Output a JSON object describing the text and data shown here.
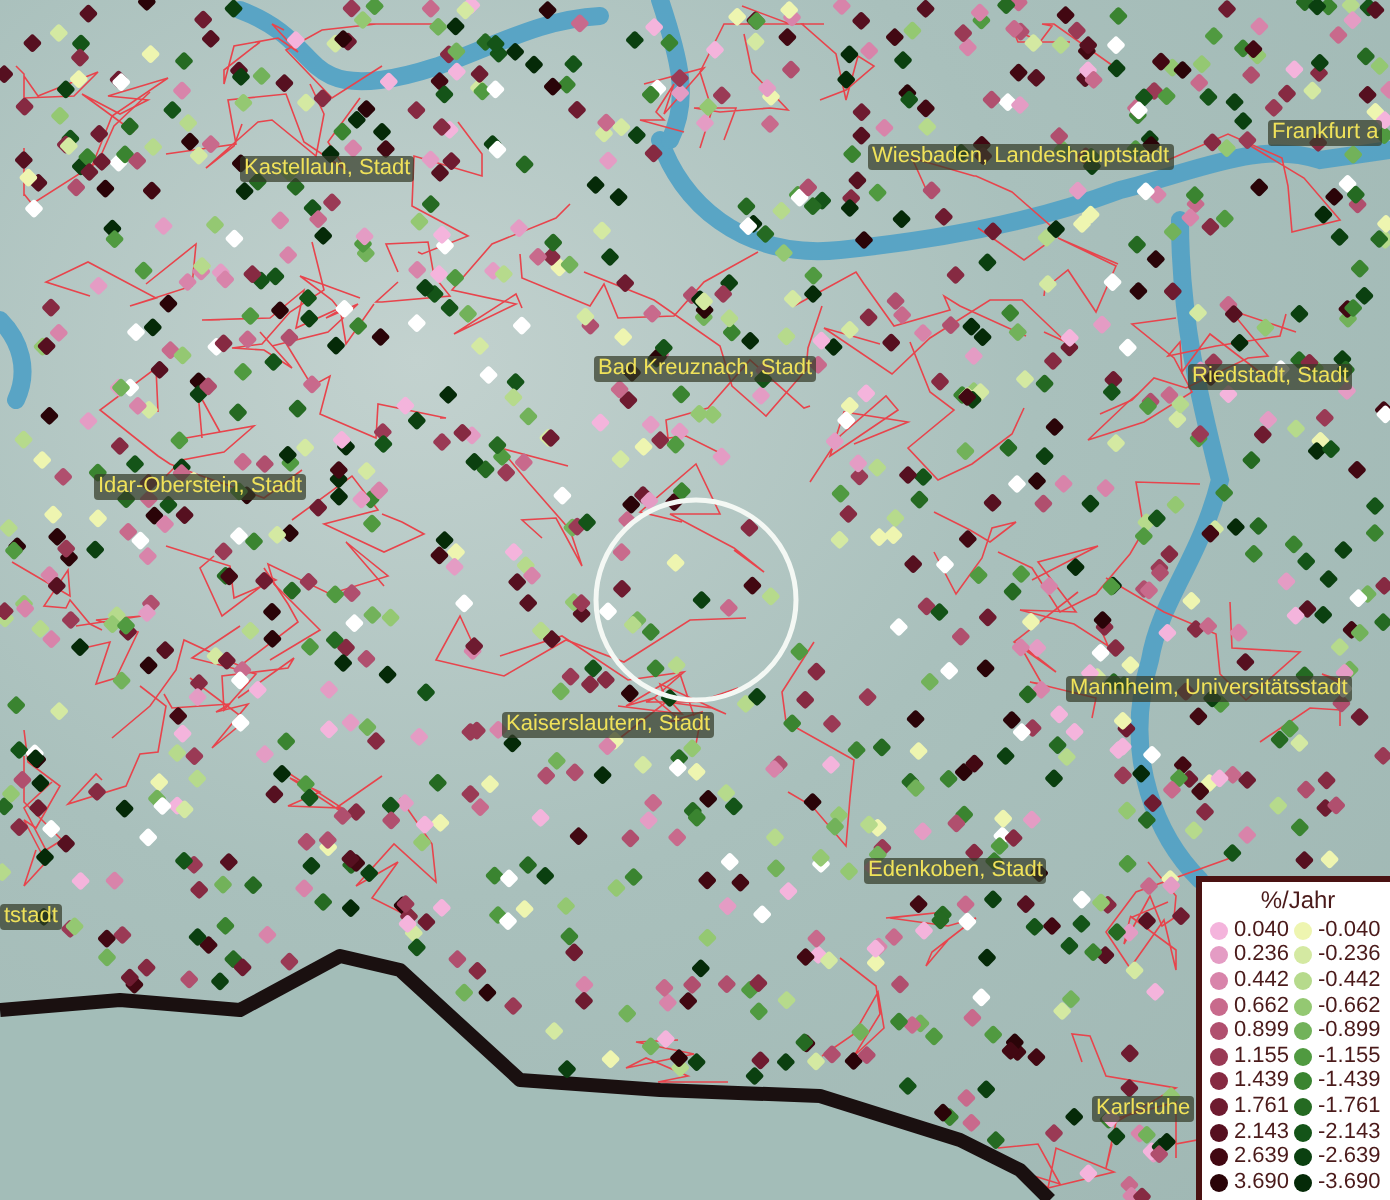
{
  "map": {
    "places": [
      {
        "name": "Kastellaun, Stadt"
      },
      {
        "name": "Wiesbaden, Landeshauptstadt"
      },
      {
        "name": "Frankfurt a"
      },
      {
        "name": "Bad Kreuznach, Stadt"
      },
      {
        "name": "Riedstadt, Stadt"
      },
      {
        "name": "Idar-Oberstein, Stadt"
      },
      {
        "name": "Kaiserslautern, Stadt"
      },
      {
        "name": "Mannheim, Universitätsstadt"
      },
      {
        "name": "tstadt"
      },
      {
        "name": "Edenkoben, Stadt"
      },
      {
        "name": "Karlsruhe"
      }
    ]
  },
  "legend": {
    "title": "%/Jahr",
    "rows": [
      {
        "left": {
          "label": "0.040",
          "color": "#f4b4dc"
        },
        "right": {
          "label": "-0.040",
          "color": "#eef5b0"
        }
      },
      {
        "left": {
          "label": "0.236",
          "color": "#e49cc4"
        },
        "right": {
          "label": "-0.236",
          "color": "#d4e9a2"
        }
      },
      {
        "left": {
          "label": "0.442",
          "color": "#d884aa"
        },
        "right": {
          "label": "-0.442",
          "color": "#b6da8c"
        }
      },
      {
        "left": {
          "label": "0.662",
          "color": "#c86a8c"
        },
        "right": {
          "label": "-0.662",
          "color": "#94c872"
        }
      },
      {
        "left": {
          "label": "0.899",
          "color": "#b04f6e"
        },
        "right": {
          "label": "-0.899",
          "color": "#72b25a"
        }
      },
      {
        "left": {
          "label": "1.155",
          "color": "#9a3a55"
        },
        "right": {
          "label": "-1.155",
          "color": "#509a40"
        }
      },
      {
        "left": {
          "label": "1.439",
          "color": "#862a42"
        },
        "right": {
          "label": "-1.439",
          "color": "#3a8430"
        }
      },
      {
        "left": {
          "label": "1.761",
          "color": "#6e1b30"
        },
        "right": {
          "label": "-1.761",
          "color": "#256a22"
        }
      },
      {
        "left": {
          "label": "2.143",
          "color": "#561020"
        },
        "right": {
          "label": "-2.143",
          "color": "#145418"
        }
      },
      {
        "left": {
          "label": "2.639",
          "color": "#420812"
        },
        "right": {
          "label": "-2.639",
          "color": "#0b4010"
        }
      },
      {
        "left": {
          "label": "3.690",
          "color": "#2a0408"
        },
        "right": {
          "label": "-3.690",
          "color": "#052a08"
        }
      }
    ]
  }
}
